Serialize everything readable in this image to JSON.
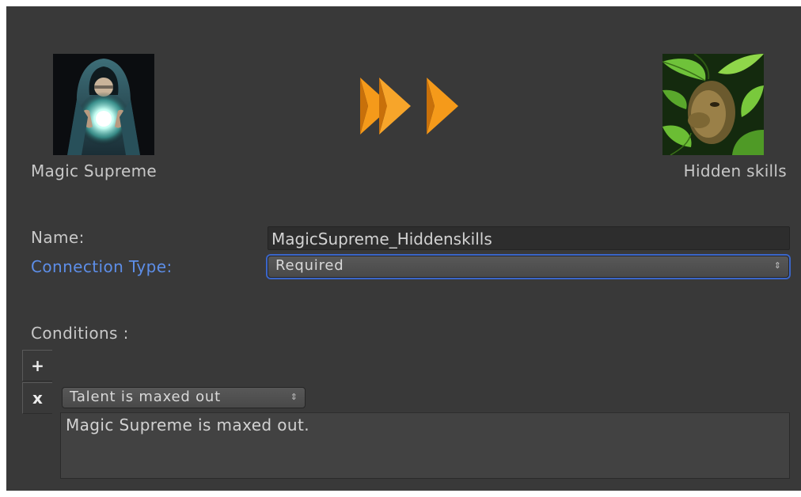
{
  "source_talent": {
    "name": "Magic Supreme",
    "icon": "hooded-mage-orb-icon"
  },
  "target_talent": {
    "name": "Hidden skills",
    "icon": "leaf-hidden-face-icon"
  },
  "connection_arrows_icon": "fast-forward-arrows-icon",
  "colors": {
    "panel_bg": "#393939",
    "arrow": "#f59a1a",
    "highlight_label": "#5d8ee8",
    "focus_ring": "#3b66c9"
  },
  "form": {
    "name_label": "Name:",
    "name_value": "MagicSupreme_Hiddenskills",
    "connection_type_label": "Connection Type:",
    "connection_type_value": "Required"
  },
  "conditions": {
    "label": "Conditions :",
    "add_button": "+",
    "remove_button": "x",
    "items": [
      {
        "type": "Talent is maxed out",
        "description": "Magic Supreme is maxed out."
      }
    ]
  },
  "dropdown_arrow": "⇕"
}
